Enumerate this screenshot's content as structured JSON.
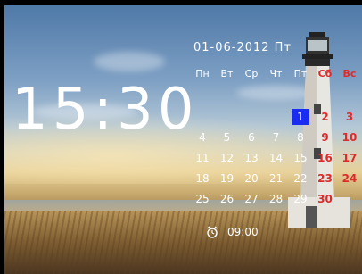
{
  "date_text": "01-06-2012 Пт",
  "time_text": "15:30",
  "weekdays": [
    "Пн",
    "Вт",
    "Ср",
    "Чт",
    "Пт",
    "Сб",
    "Вс"
  ],
  "weeks": [
    [
      "",
      "",
      "",
      "",
      "1",
      "2",
      "3"
    ],
    [
      "4",
      "5",
      "6",
      "7",
      "8",
      "9",
      "10"
    ],
    [
      "11",
      "12",
      "13",
      "14",
      "15",
      "16",
      "17"
    ],
    [
      "18",
      "19",
      "20",
      "21",
      "22",
      "23",
      "24"
    ],
    [
      "25",
      "26",
      "27",
      "28",
      "29",
      "30",
      ""
    ]
  ],
  "today": "1",
  "alarm": {
    "icon": "alarm-clock-icon",
    "time": "09:00"
  },
  "colors": {
    "weekend": "#e02a2a",
    "today_bg": "#1a2cf0",
    "text": "#ffffff"
  }
}
